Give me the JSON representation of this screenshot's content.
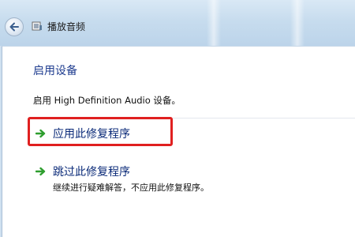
{
  "window": {
    "title": "播放音频"
  },
  "content": {
    "heading": "启用设备",
    "description": "启用 High Definition Audio 设备。"
  },
  "options": [
    {
      "label": "应用此修复程序",
      "sublabel": "",
      "highlighted": true
    },
    {
      "label": "跳过此修复程序",
      "sublabel": "继续进行疑难解答，不应用此修复程序。",
      "highlighted": false
    }
  ],
  "icons": {
    "back": "back-arrow-icon",
    "title": "troubleshooter-icon",
    "option": "green-arrow-icon"
  },
  "colors": {
    "heading": "#1e3c8f",
    "option_link": "#0a2a78",
    "highlight": "#e02020",
    "arrow": "#2e9e2e"
  }
}
